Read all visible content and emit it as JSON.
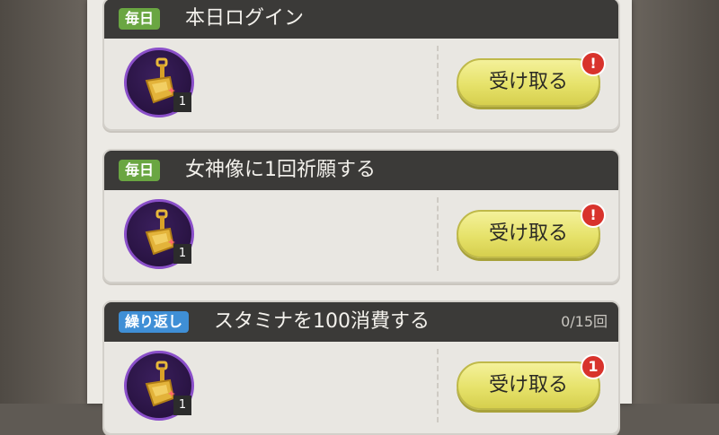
{
  "missions": [
    {
      "badge": "毎日",
      "badge_type": "daily",
      "title": "本日ログイン",
      "progress": "",
      "reward": {
        "icon": "shovel-icon",
        "quantity": "1"
      },
      "claim_label": "受け取る",
      "alert": "!"
    },
    {
      "badge": "毎日",
      "badge_type": "daily",
      "title": "女神像に1回祈願する",
      "progress": "",
      "reward": {
        "icon": "shovel-icon",
        "quantity": "1"
      },
      "claim_label": "受け取る",
      "alert": "!"
    },
    {
      "badge": "繰り返し",
      "badge_type": "repeat",
      "title": "スタミナを100消費する",
      "progress": "0/15回",
      "reward": {
        "icon": "shovel-icon",
        "quantity": "1"
      },
      "claim_label": "受け取る",
      "alert": "1"
    }
  ],
  "colors": {
    "daily_badge": "#6aa642",
    "repeat_badge": "#3f8fd6",
    "claim_button": "#e6e26a",
    "alert": "#d8332c",
    "reward_frame": "#8a4fc9"
  }
}
